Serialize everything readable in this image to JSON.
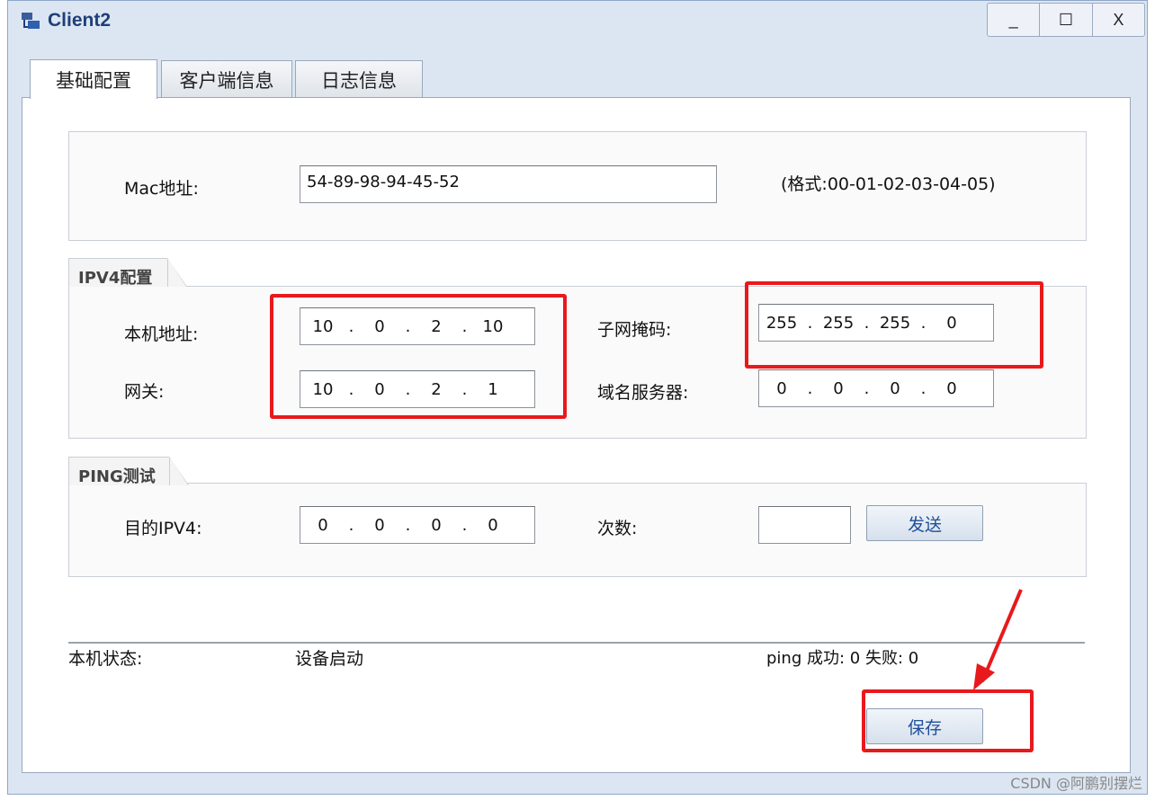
{
  "window": {
    "title": "Client2",
    "app_icon": "client-network-icon",
    "controls": {
      "minimize": "_",
      "maximize": "☐",
      "close": "X"
    }
  },
  "tabs": [
    {
      "label": "基础配置",
      "active": true
    },
    {
      "label": "客户端信息",
      "active": false
    },
    {
      "label": "日志信息",
      "active": false
    }
  ],
  "mac": {
    "label": "Mac地址:",
    "value": "54-89-98-94-45-52",
    "format_hint": "(格式:00-01-02-03-04-05)"
  },
  "ipv4": {
    "legend": "IPV4配置",
    "local_ip": {
      "label": "本机地址:",
      "octets": [
        "10",
        "0",
        "2",
        "10"
      ]
    },
    "gateway": {
      "label": "网关:",
      "octets": [
        "10",
        "0",
        "2",
        "1"
      ]
    },
    "subnet_mask": {
      "label": "子网掩码:",
      "octets": [
        "255",
        "255",
        "255",
        "0"
      ]
    },
    "dns": {
      "label": "域名服务器:",
      "octets": [
        "0",
        "0",
        "0",
        "0"
      ]
    }
  },
  "ping": {
    "legend": "PING测试",
    "target_label": "目的IPV4:",
    "target_octets": [
      "0",
      "0",
      "0",
      "0"
    ],
    "count_label": "次数:",
    "count_value": "",
    "send_label": "发送"
  },
  "status": {
    "label": "本机状态:",
    "value": "设备启动",
    "ping_result": "ping 成功: 0 失败: 0"
  },
  "save_label": "保存",
  "watermark": "CSDN @阿鹏别摆烂",
  "colors": {
    "highlight": "#e8191c",
    "title": "#1e3f7a",
    "button_text": "#1f4f9a"
  }
}
